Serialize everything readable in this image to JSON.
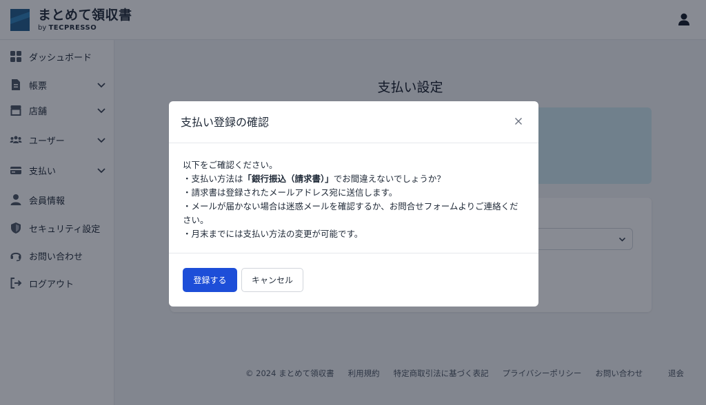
{
  "app": {
    "title": "まとめて領収書",
    "by": "by",
    "vendor": "TECPRESSO"
  },
  "sidebar": {
    "items": [
      {
        "label": "ダッシュボード",
        "icon": "dashboard-icon",
        "expandable": false
      },
      {
        "label": "帳票",
        "icon": "document-icon",
        "expandable": true
      },
      {
        "label": "店舗",
        "icon": "store-icon",
        "expandable": true
      },
      {
        "label": "ユーザー",
        "icon": "users-icon",
        "expandable": true
      },
      {
        "label": "支払い",
        "icon": "credit-card-icon",
        "expandable": true
      },
      {
        "label": "会員情報",
        "icon": "person-icon",
        "expandable": false
      },
      {
        "label": "セキュリティ設定",
        "icon": "shield-icon",
        "expandable": false
      },
      {
        "label": "お問い合わせ",
        "icon": "headset-icon",
        "expandable": false
      },
      {
        "label": "ログアウト",
        "icon": "logout-icon",
        "expandable": false
      }
    ]
  },
  "main": {
    "title": "支払い設定"
  },
  "footer": {
    "copyright": "© 2024 まとめて領収書",
    "terms": "利用規約",
    "commerce": "特定商取引法に基づく表記",
    "privacy": "プライバシーポリシー",
    "contact": "お問い合わせ",
    "withdraw": "退会"
  },
  "modal": {
    "title": "支払い登録の確認",
    "intro": "以下をご確認ください。",
    "line1_prefix": "・支払い方法は",
    "line1_bold": "「銀行振込（請求書）」",
    "line1_suffix": "でお間違えないでしょうか？",
    "line2": "・請求書は登録されたメールアドレス宛に送信します。",
    "line3": "・メールが届かない場合は迷惑メールを確認するか、お問合せフォームよりご連絡ください。",
    "line4": "・月末までには支払い方法の変更が可能です。",
    "confirm_label": "登録する",
    "cancel_label": "キャンセル"
  },
  "colors": {
    "primary": "#1d4ed8",
    "info_panel": "#cfe8f0",
    "overlay": "rgba(17,24,39,0.5)"
  }
}
